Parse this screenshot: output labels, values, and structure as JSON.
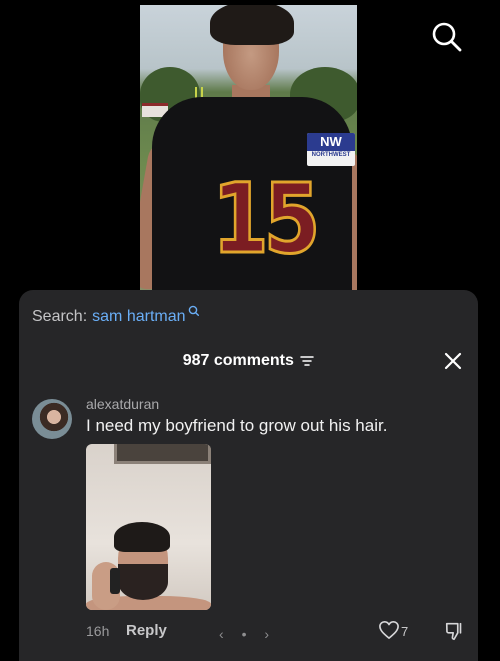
{
  "video": {
    "jersey_number": "15",
    "patch_top": "NW",
    "patch_bottom": "NORTHWEST"
  },
  "search": {
    "label": "Search:",
    "term": "sam hartman",
    "link_color": "#6aaef6"
  },
  "comments": {
    "count_label": "987 comments",
    "items": [
      {
        "username": "alexatduran",
        "text": "I need my boyfriend to grow out his hair.",
        "age": "16h",
        "reply_label": "Reply",
        "likes": "7",
        "pager": {
          "prev": "‹",
          "dot": "•",
          "next": "›"
        }
      }
    ]
  },
  "icons": [
    "search-icon",
    "magnifier-mini-icon",
    "filter-icon",
    "close-icon",
    "heart-icon",
    "dislike-icon",
    "chevron-left-icon",
    "chevron-right-icon"
  ],
  "theme": {
    "sheet_bg": "#262628",
    "page_bg": "#000000"
  }
}
